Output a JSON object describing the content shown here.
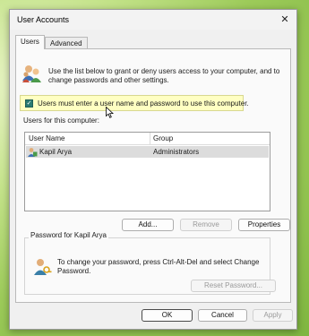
{
  "window": {
    "title": "User Accounts",
    "close_glyph": "✕"
  },
  "tabs": [
    {
      "label": "Users",
      "active": true
    },
    {
      "label": "Advanced",
      "active": false
    }
  ],
  "intro": {
    "text": "Use the list below to grant or deny users access to your computer, and to change passwords and other settings."
  },
  "require_login": {
    "checked": true,
    "label": "Users must enter a user name and password to use this computer."
  },
  "users_section": {
    "label": "Users for this computer:"
  },
  "users_table": {
    "columns": [
      "User Name",
      "Group"
    ],
    "rows": [
      {
        "name": "Kapil Arya",
        "group": "Administrators",
        "selected": true
      }
    ]
  },
  "buttons": {
    "add": "Add...",
    "remove": "Remove",
    "properties": "Properties"
  },
  "password_group": {
    "title": "Password for Kapil Arya",
    "text": "To change your password, press Ctrl-Alt-Del and select Change Password.",
    "reset_button": "Reset Password..."
  },
  "footer": {
    "ok": "OK",
    "cancel": "Cancel",
    "apply": "Apply"
  },
  "colors": {
    "checkbox": "#2a7a72",
    "highlight": "#ffffc2",
    "accent": "#0078d4"
  },
  "icons": [
    "users-icon",
    "user-row-icon",
    "key-user-icon",
    "close-icon",
    "mouse-cursor-icon",
    "checkmark-icon"
  ]
}
